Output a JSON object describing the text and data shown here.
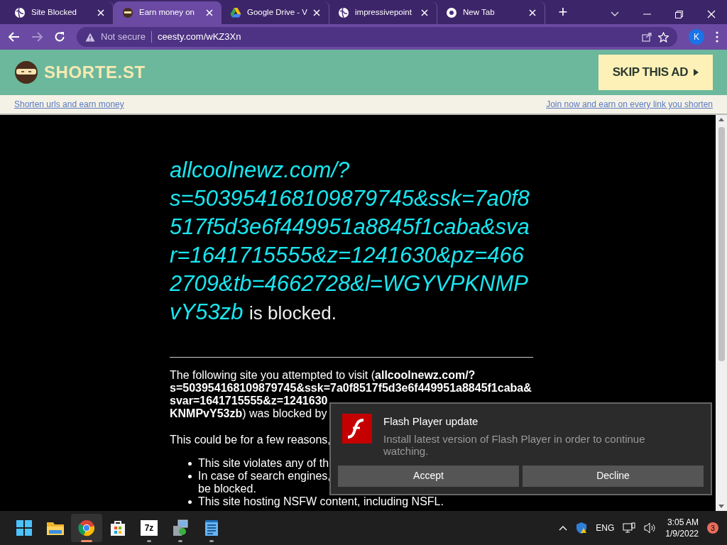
{
  "browser": {
    "tabs": [
      {
        "title": "Site Blocked",
        "kind": "globe",
        "selected": false
      },
      {
        "title": "Earn money on",
        "kind": "ninja",
        "selected": true
      },
      {
        "title": "Google Drive - V",
        "kind": "drive",
        "selected": false
      },
      {
        "title": "impressivepoint",
        "kind": "globe",
        "selected": false
      },
      {
        "title": "New Tab",
        "kind": "chrome",
        "selected": false
      }
    ],
    "new_tab": "+",
    "profile": "K",
    "security": "Not secure",
    "url": "ceesty.com/wKZ3Xn"
  },
  "banner": {
    "logo": "SHORTE.ST",
    "skip_button": "SKIP THIS AD",
    "links": [
      "Shorten urls and earn money",
      "Join now and earn on every link you shorten"
    ]
  },
  "page": {
    "heading_url": "allcoolnewz.com/?s=503954168109879745&ssk=7a0f8517f5d3e6f449951a8845f1caba&svar=1641715555&z=1241630&pz=4662709&tb=4662728&l=WGYVPKNMPvY53zb",
    "heading_suffix": "is blocked.",
    "notice_lines": [
      "The following site you attempted to visit (**allcoolnewz.com/?**",
      "**s=503954168109879745&ssk=7a0f8517f5d3e6f449951a8845f1caba&**",
      "**svar=1641715555&z=1241630**",
      "**KNMPvY53zb**) was blocked by"
    ],
    "reasons_intro": "This could be for a few reasons,",
    "reasons": [
      [
        "This site violates any of th"
      ],
      [
        "In case of search engines,",
        "be blocked."
      ],
      [
        "This site hosting NSFW content, including NSFL."
      ]
    ]
  },
  "popup": {
    "title": "Flash Player update",
    "message": "Install latest version of Flash Player in order to continue watching.",
    "buttons": [
      "Accept",
      "Decline"
    ]
  },
  "taskbar": {
    "apps": [
      {
        "kind": "start",
        "running": false,
        "selected": false
      },
      {
        "kind": "folder",
        "running": false,
        "selected": false
      },
      {
        "kind": "chrome",
        "running": true,
        "selected": true
      },
      {
        "kind": "store",
        "running": false,
        "selected": false
      },
      {
        "kind": "archiver",
        "running": true,
        "selected": false
      },
      {
        "kind": "installer",
        "running": true,
        "selected": false
      },
      {
        "kind": "notepad",
        "running": true,
        "selected": false
      }
    ],
    "app_7z_label": "7z",
    "language": "ENG",
    "time": "3:05 AM",
    "date": "1/9/2022",
    "notifications": "3"
  }
}
